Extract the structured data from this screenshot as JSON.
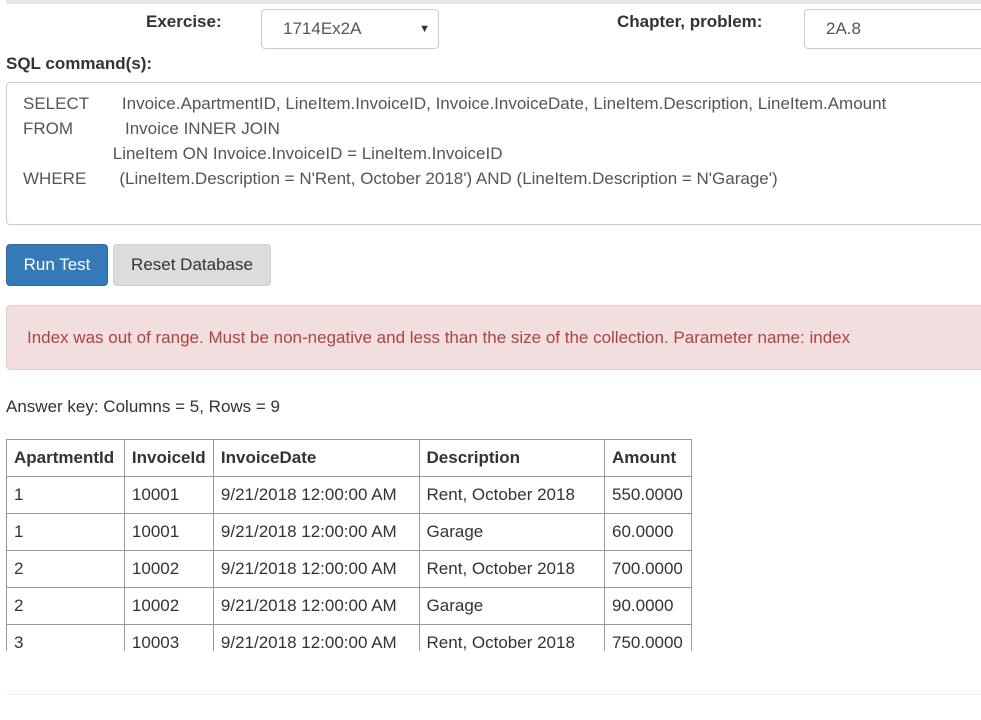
{
  "form": {
    "exercise_label": "Exercise:",
    "exercise_value": "1714Ex2A",
    "chapter_label": "Chapter, problem:",
    "chapter_value": "2A.8",
    "sql_label": "SQL command(s):"
  },
  "sql": {
    "lines": [
      "SELECT       Invoice.ApartmentID, LineItem.InvoiceID, Invoice.InvoiceDate, LineItem.Description, LineItem.Amount",
      "FROM           Invoice INNER JOIN",
      "                   LineItem ON Invoice.InvoiceID = LineItem.InvoiceID",
      "WHERE       (LineItem.Description = N'Rent, October 2018') AND (LineItem.Description = N'Garage')"
    ]
  },
  "buttons": {
    "run_label": "Run Test",
    "reset_label": "Reset Database"
  },
  "alert": {
    "message": "Index was out of range. Must be non-negative and less than the size of the collection. Parameter name: index"
  },
  "answer_key": {
    "summary": "Answer key: Columns = 5, Rows = 9",
    "headers": [
      "ApartmentId",
      "InvoiceId",
      "InvoiceDate",
      "Description",
      "Amount"
    ],
    "rows": [
      [
        "1",
        "10001",
        "9/21/2018 12:00:00 AM",
        "Rent, October 2018",
        "550.0000"
      ],
      [
        "1",
        "10001",
        "9/21/2018 12:00:00 AM",
        "Garage",
        "60.0000"
      ],
      [
        "2",
        "10002",
        "9/21/2018 12:00:00 AM",
        "Rent, October 2018",
        "700.0000"
      ],
      [
        "2",
        "10002",
        "9/21/2018 12:00:00 AM",
        "Garage",
        "90.0000"
      ],
      [
        "3",
        "10003",
        "9/21/2018 12:00:00 AM",
        "Rent, October 2018",
        "750.0000"
      ]
    ]
  },
  "icons": {
    "select_arrow": "caret-down-icon"
  },
  "colors": {
    "primary": "#337ab7",
    "alert_bg": "#f2dede",
    "alert_text": "#a94442"
  }
}
